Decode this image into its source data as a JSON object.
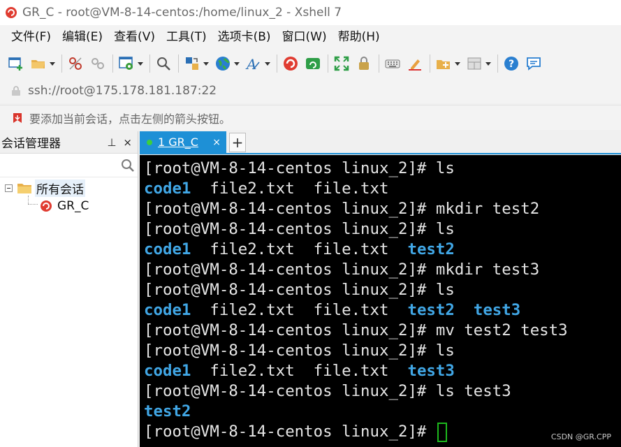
{
  "window": {
    "title": "GR_C - root@VM-8-14-centos:/home/linux_2 - Xshell 7"
  },
  "menu": [
    "文件(F)",
    "编辑(E)",
    "查看(V)",
    "工具(T)",
    "选项卡(B)",
    "窗口(W)",
    "帮助(H)"
  ],
  "address": {
    "url": "ssh://root@175.178.181.187:22"
  },
  "hint": {
    "text": "要添加当前会话，点击左侧的箭头按钮。"
  },
  "session_manager": {
    "title": "会话管理器",
    "pin": "⊥",
    "close": "×",
    "folder": "所有会话",
    "session": "GR_C"
  },
  "tabs": [
    {
      "label": "1 GR_C",
      "close": "×",
      "status_color": "#3ccf3c"
    }
  ],
  "tab_add": "+",
  "terminal": {
    "lines": [
      [
        {
          "t": "[root@VM-8-14-centos linux_2]# ls"
        }
      ],
      [
        {
          "t": "code1",
          "dir": true
        },
        {
          "t": "  file2.txt  file.txt"
        }
      ],
      [
        {
          "t": "[root@VM-8-14-centos linux_2]# mkdir test2"
        }
      ],
      [
        {
          "t": "[root@VM-8-14-centos linux_2]# ls"
        }
      ],
      [
        {
          "t": "code1",
          "dir": true
        },
        {
          "t": "  file2.txt  file.txt  "
        },
        {
          "t": "test2",
          "dir": true
        }
      ],
      [
        {
          "t": "[root@VM-8-14-centos linux_2]# mkdir test3"
        }
      ],
      [
        {
          "t": "[root@VM-8-14-centos linux_2]# ls"
        }
      ],
      [
        {
          "t": "code1",
          "dir": true
        },
        {
          "t": "  file2.txt  file.txt  "
        },
        {
          "t": "test2",
          "dir": true
        },
        {
          "t": "  "
        },
        {
          "t": "test3",
          "dir": true
        }
      ],
      [
        {
          "t": "[root@VM-8-14-centos linux_2]# mv test2 test3"
        }
      ],
      [
        {
          "t": "[root@VM-8-14-centos linux_2]# ls"
        }
      ],
      [
        {
          "t": "code1",
          "dir": true
        },
        {
          "t": "  file2.txt  file.txt  "
        },
        {
          "t": "test3",
          "dir": true
        }
      ],
      [
        {
          "t": "[root@VM-8-14-centos linux_2]# ls test3"
        }
      ],
      [
        {
          "t": "test2",
          "dir": true
        }
      ],
      [
        {
          "t": "[root@VM-8-14-centos linux_2]# "
        }
      ]
    ],
    "colors": {
      "background": "#000000",
      "text": "#e6e6e6",
      "directory": "#41a7e6",
      "cursor": "#1db81d"
    }
  },
  "watermark": "CSDN @GR.CPP",
  "toolbar_icons": [
    "new-session-icon",
    "open-folder-icon",
    "disconnect-icon",
    "reconnect-icon",
    "properties-icon",
    "find-icon",
    "transfer-icon",
    "globe-icon",
    "font-icon",
    "xshell-icon",
    "xftp-icon",
    "fullscreen-icon",
    "lock-icon",
    "keyboard-icon",
    "highlight-icon",
    "compose-icon",
    "layout-icon",
    "help-icon",
    "chat-icon"
  ]
}
